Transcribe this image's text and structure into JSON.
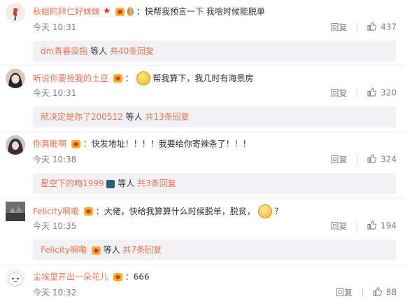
{
  "comments": [
    {
      "name": "秋姐的拜仁好妹妹",
      "colon": "：",
      "text": "快帮我预言一下 我啥时候能脱单",
      "time": "今天 10:31",
      "reply": "回复",
      "likes": "437",
      "sub": {
        "name": "dm青春染指",
        "mid": "等人",
        "count": "共40条回复"
      }
    },
    {
      "name": "听说你要抢我的土豆",
      "colon": "：",
      "text": "帮我算下，我几时有海景房",
      "time": "今天 10:31",
      "reply": "回复",
      "likes": "320",
      "sub": {
        "name": "就决定是你了200512",
        "mid": "等人",
        "count": "共13条回复"
      }
    },
    {
      "name": "你真脏啊",
      "colon": "：",
      "text": "快发地址！！！！我要给你寄辣条了！！！",
      "time": "今天 10:38",
      "reply": "回复",
      "likes": "324",
      "sub": {
        "name": "星空下的吻1999",
        "mid": "等人",
        "count": "共3条回复"
      }
    },
    {
      "name": "Felicity啊嘞",
      "colon": "：",
      "text": "大佬，快给我算算什么时候脱单，脱贫，",
      "text_after": "？",
      "time": "今天 10:35",
      "reply": "回复",
      "likes": "194",
      "sub": {
        "name": "Felicity啊嘞",
        "mid": "等人",
        "count": "共7条回复"
      }
    },
    {
      "name": "尘埃里开出一朵花儿",
      "colon": "：",
      "text": "666",
      "time": "今天 10:32",
      "reply": "回复",
      "likes": "88"
    }
  ],
  "colors": {
    "accent": "#eb7350",
    "muted": "#808080",
    "subbox": "#f2f2f5"
  }
}
